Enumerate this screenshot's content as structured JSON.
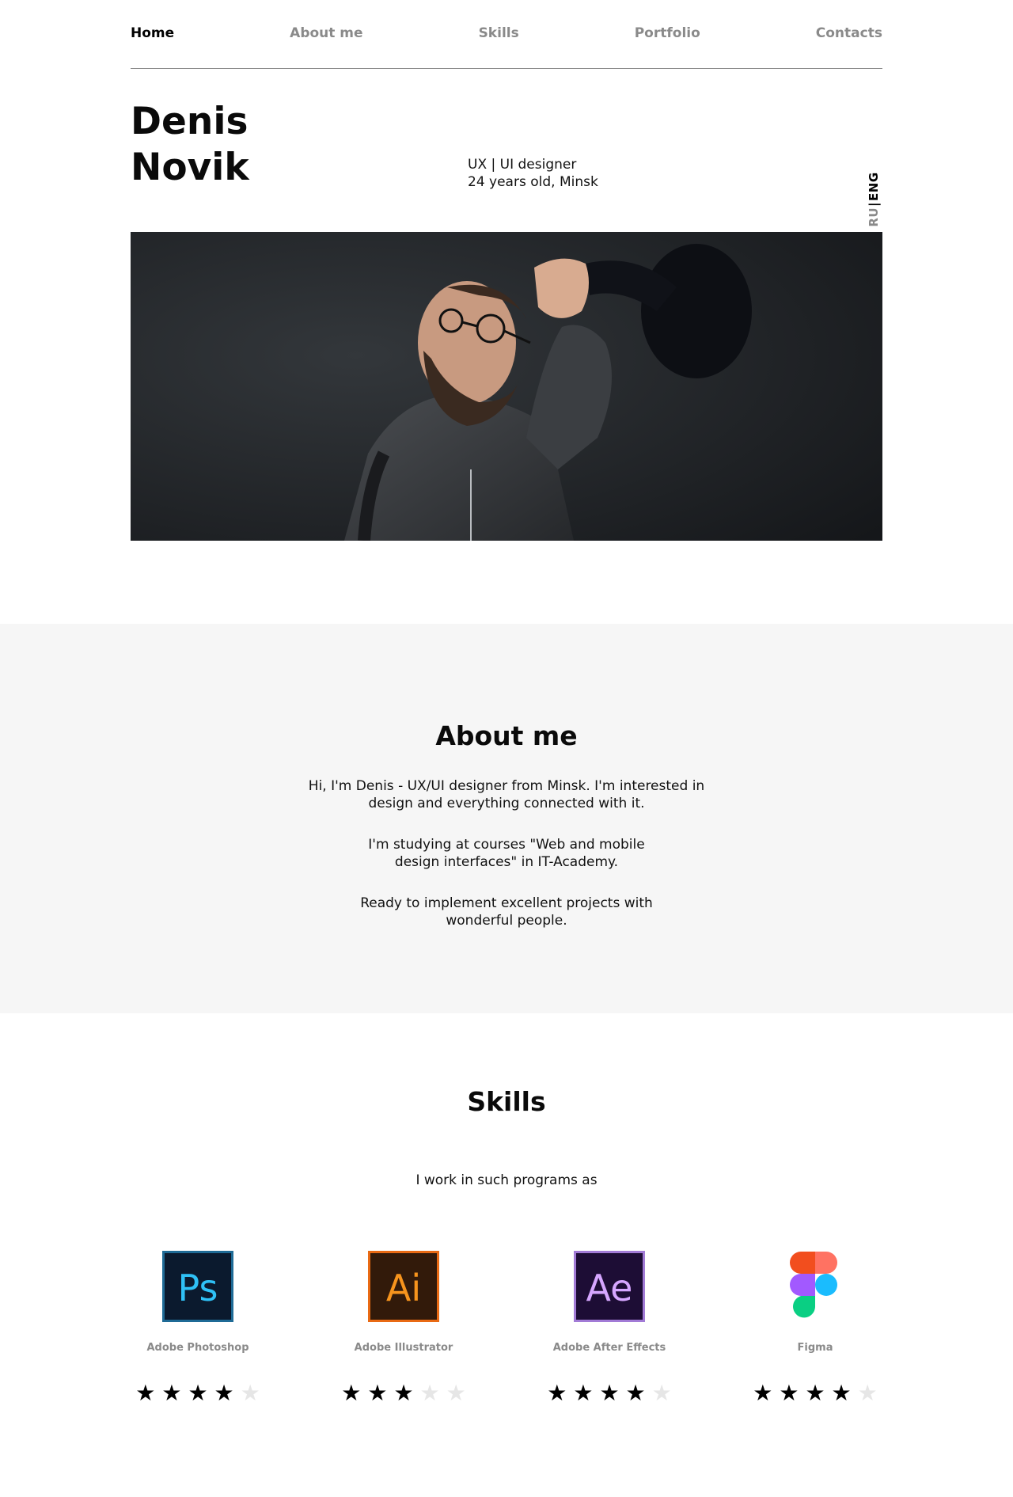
{
  "nav": {
    "items": [
      {
        "label": "Home",
        "active": true
      },
      {
        "label": "About me",
        "active": false
      },
      {
        "label": "Skills",
        "active": false
      },
      {
        "label": "Portfolio",
        "active": false
      },
      {
        "label": "Contacts",
        "active": false
      }
    ]
  },
  "hero": {
    "first_name": "Denis",
    "last_name": "Novik",
    "role": "UX | UI designer",
    "age_city": "24 years old, Minsk",
    "lang": {
      "ru": "RU",
      "separator": "|",
      "eng": "ENG",
      "active": "ENG"
    }
  },
  "about": {
    "title": "About me",
    "paragraphs": [
      "Hi, I'm Denis - UX/UI designer from Minsk. I'm interested in design and everything connected with it.",
      "I'm studying at courses \"Web and mobile design interfaces\" in IT-Academy.",
      "Ready to implement excellent projects with wonderful people."
    ]
  },
  "skills": {
    "title": "Skills",
    "intro": "I work in such programs as",
    "items": [
      {
        "name": "Adobe Photoshop",
        "icon": "photoshop-icon",
        "logo_text": "Ps",
        "rating": 4,
        "max": 5
      },
      {
        "name": "Adobe Illustrator",
        "icon": "illustrator-icon",
        "logo_text": "Ai",
        "rating": 3,
        "max": 5
      },
      {
        "name": "Adobe After Effects",
        "icon": "after-effects-icon",
        "logo_text": "Ae",
        "rating": 4,
        "max": 5
      },
      {
        "name": "Figma",
        "icon": "figma-icon",
        "logo_text": "",
        "rating": 4,
        "max": 5
      }
    ]
  },
  "colors": {
    "nav_inactive": "#8a8a8a",
    "about_bg": "#f6f6f6",
    "star_on": "#000000",
    "star_off": "#e6e6e6"
  }
}
